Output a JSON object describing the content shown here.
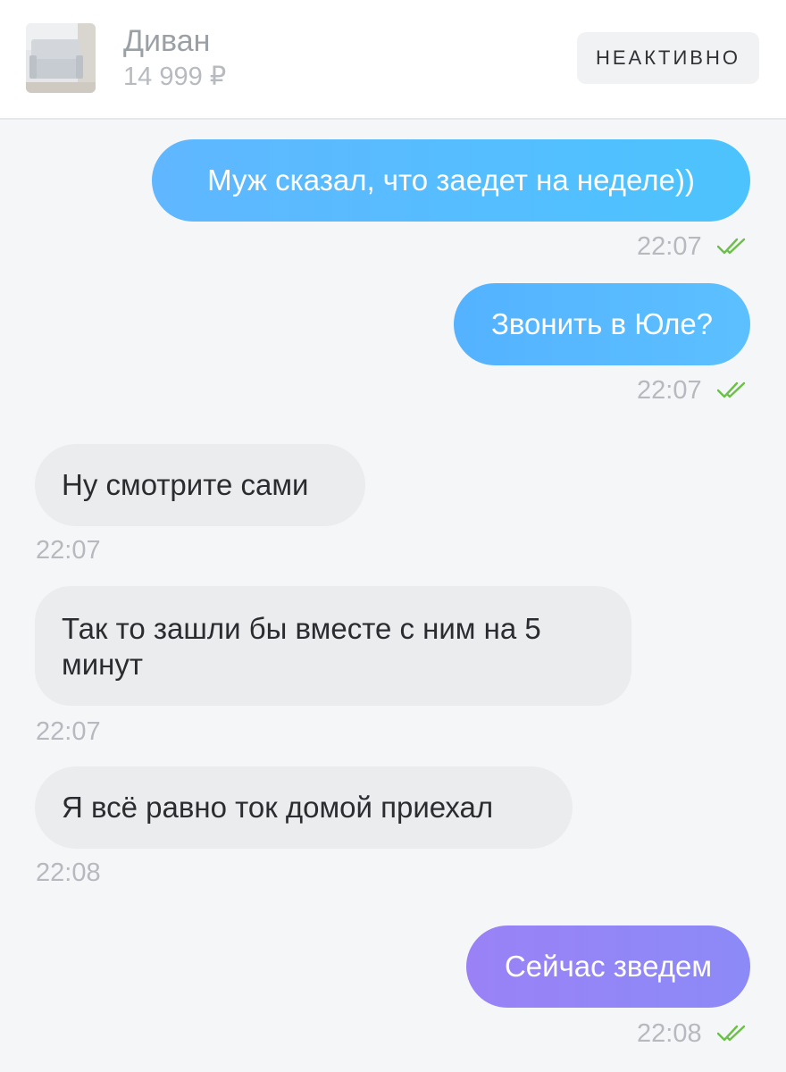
{
  "header": {
    "product_title": "Диван",
    "product_price": "14 999 ₽",
    "status": "НЕАКТИВНО",
    "thumbnail_icon": "sofa-thumbnail"
  },
  "messages": [
    {
      "direction": "outgoing",
      "text": "Муж сказал, что заедет на неделе))",
      "time": "22:07",
      "read": true,
      "color": "#5cbcff"
    },
    {
      "direction": "outgoing",
      "text": "Звонить в Юле?",
      "time": "22:07",
      "read": true,
      "color": "#5cbcff"
    },
    {
      "direction": "incoming",
      "text": "Ну смотрите сами",
      "time": "22:07"
    },
    {
      "direction": "incoming",
      "text": "Так то зашли бы вместе с ним на 5 минут",
      "time": "22:07"
    },
    {
      "direction": "incoming",
      "text": "Я всё равно ток домой приехал",
      "time": "22:08"
    },
    {
      "direction": "outgoing",
      "text": "Сейчас зведем",
      "time": "22:08",
      "read": true,
      "color": "#9587f6"
    }
  ],
  "colors": {
    "read_check": "#6cc04a",
    "incoming_bubble": "#ebecee",
    "background": "#f5f6f8"
  }
}
